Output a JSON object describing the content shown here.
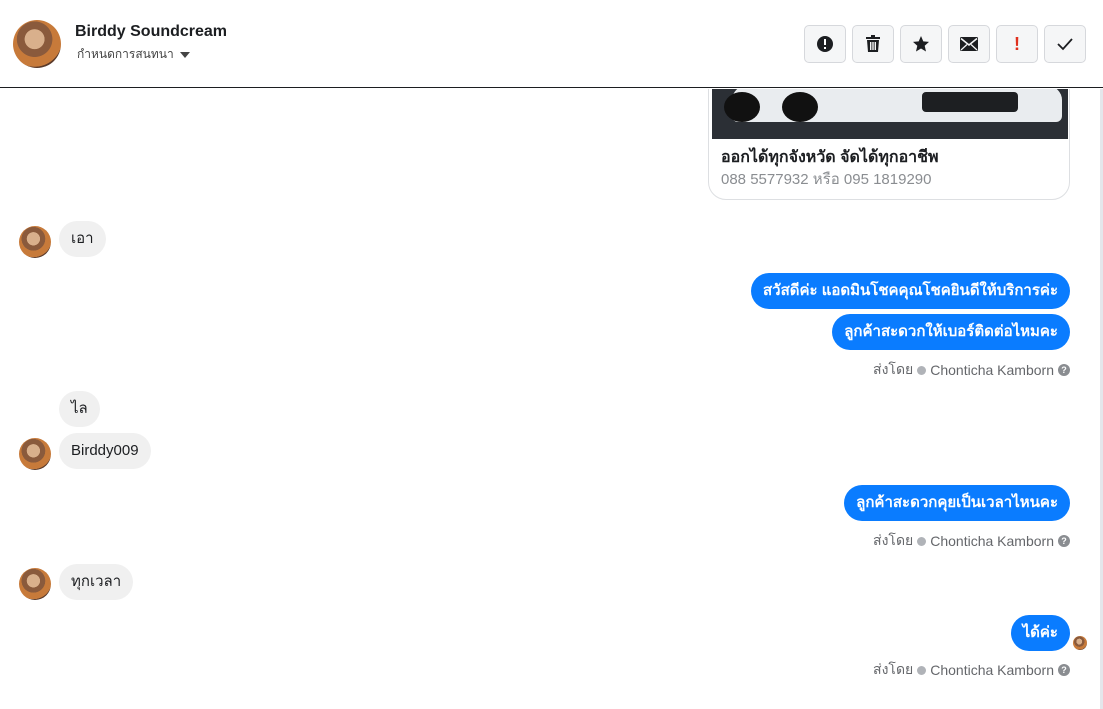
{
  "header": {
    "contact_name": "Birddy Soundcream",
    "assign_label": "กำหนดการสนทนา",
    "actions": [
      {
        "name": "report-spam-button",
        "icon": "alert-circle-icon"
      },
      {
        "name": "delete-button",
        "icon": "trash-icon"
      },
      {
        "name": "star-button",
        "icon": "star-icon"
      },
      {
        "name": "mark-unread-button",
        "icon": "envelope-icon"
      },
      {
        "name": "important-button",
        "icon": "exclamation-icon",
        "label": "!"
      },
      {
        "name": "mark-done-button",
        "icon": "check-icon"
      }
    ]
  },
  "card": {
    "title": "ออกได้ทุกจังหวัด จัดได้ทุกอาชีพ",
    "subtitle": "088 5577932 หรือ 095 1819290"
  },
  "messages": {
    "in_1": "เอา",
    "out_1": "สวัสดีค่ะ แอดมินโชคคุณโชคยินดีให้บริการค่ะ",
    "out_2": "ลูกค้าสะดวกให้เบอร์ติดต่อไหมคะ",
    "in_2": "ไล",
    "in_3": "Birddy009",
    "out_3": "ลูกค้าสะดวกคุยเป็นเวลาไหนคะ",
    "in_4": "ทุกเวลา",
    "out_4": "ได้ค่ะ"
  },
  "sent_by": {
    "prefix": "ส่งโดย",
    "agent": "Chonticha Kamborn",
    "help": "?"
  },
  "colors": {
    "outgoing_bubble": "#0a7cff",
    "incoming_bubble": "#f0f0f0",
    "important_icon": "#e0301e"
  }
}
